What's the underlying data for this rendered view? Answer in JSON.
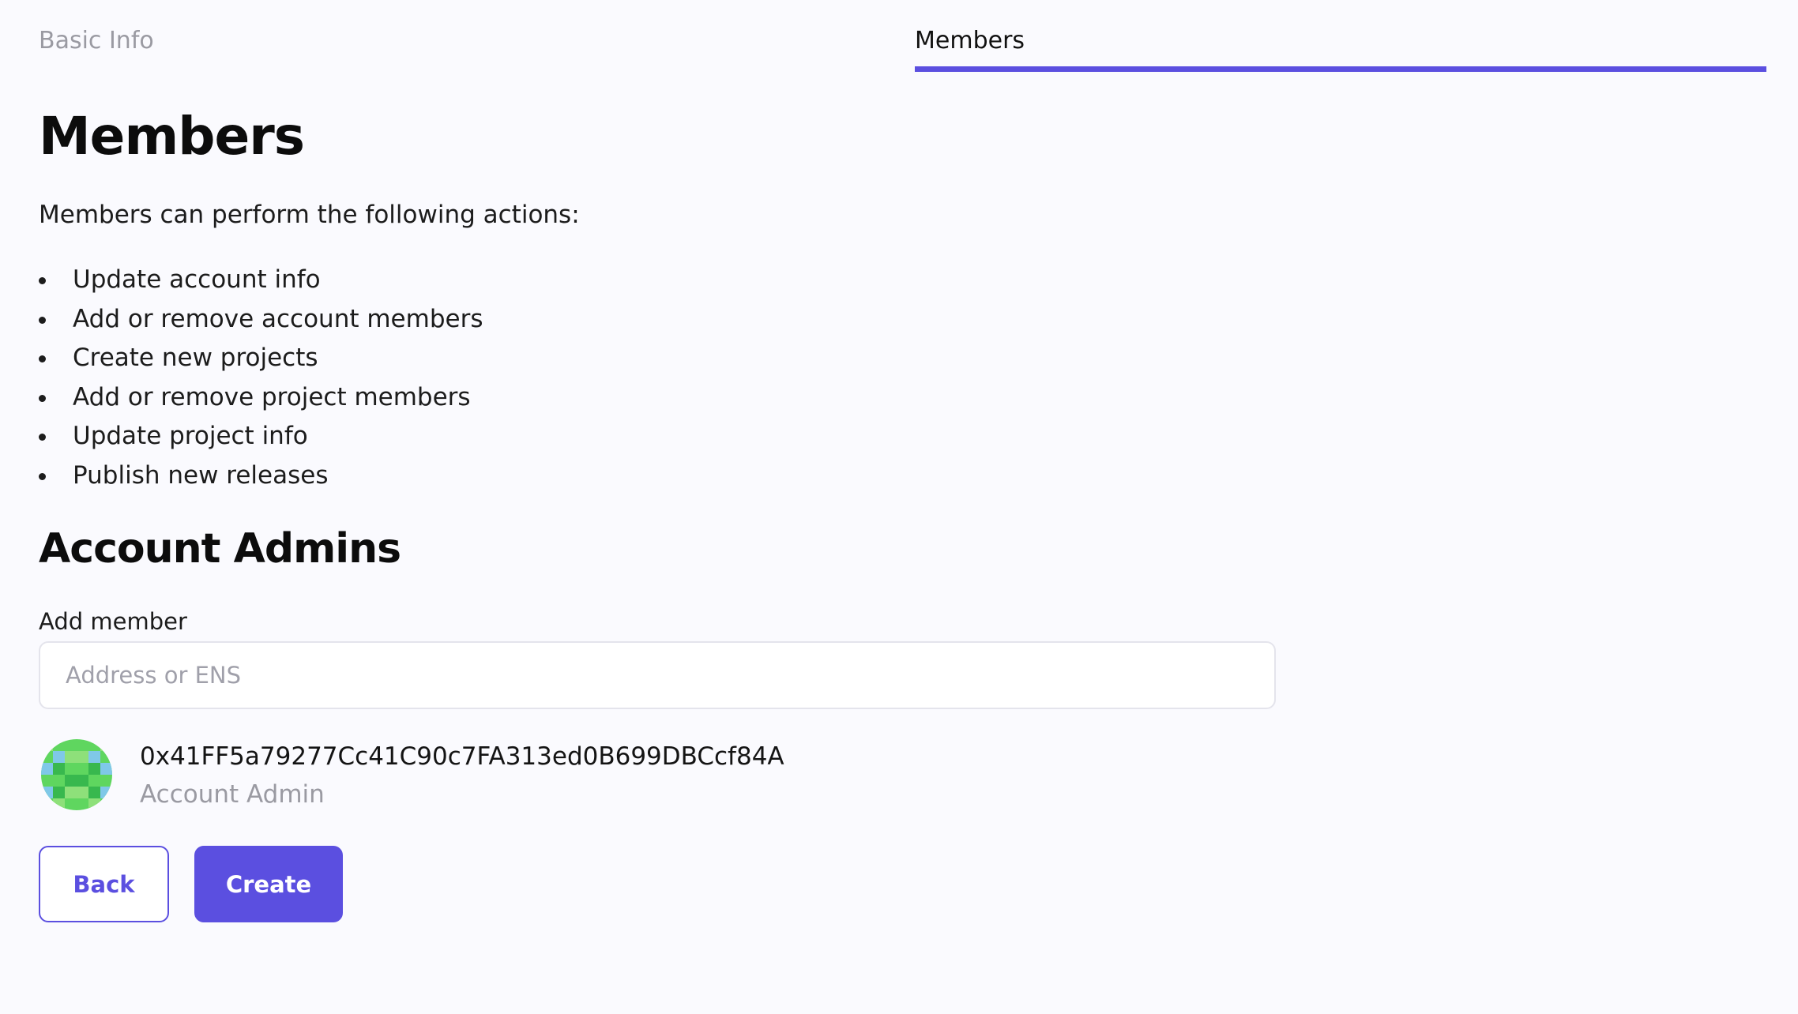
{
  "tabs": {
    "basic_info": "Basic Info",
    "members": "Members",
    "active": "Members",
    "accent_color": "#5b4fe0"
  },
  "page": {
    "title": "Members",
    "intro": "Members can perform the following actions:",
    "actions": [
      "Update account info",
      "Add or remove account members",
      "Create new projects",
      "Add or remove project members",
      "Update project info",
      "Publish new releases"
    ]
  },
  "admins": {
    "heading": "Account Admins",
    "add_member_label": "Add member",
    "input_placeholder": "Address or ENS",
    "input_value": "",
    "members": [
      {
        "address": "0x41FF5a79277Cc41C90c7FA313ed0B699DBCcf84A",
        "role": "Account Admin",
        "avatar_icon": "identicon-avatar",
        "avatar_colors": [
          "#5fd65f",
          "#8ee07a",
          "#38b84e",
          "#7fc8e8"
        ]
      }
    ]
  },
  "buttons": {
    "back": "Back",
    "create": "Create"
  }
}
